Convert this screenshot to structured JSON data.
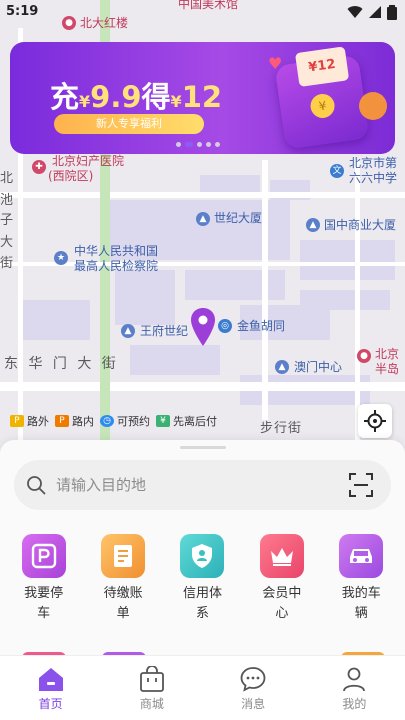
{
  "status_bar": {
    "time": "5:19"
  },
  "map": {
    "labels": [
      "北大红楼",
      "中国美术馆",
      "北京妇产医院",
      "(西院区)",
      "北京市第",
      "六六中学",
      "世纪大厦",
      "国中商业大厦",
      "中华人民共和国",
      "最高人民检察院",
      "王府世纪",
      "金鱼胡同",
      "澳门中心",
      "北京",
      "半岛",
      "东 华 门 大 街",
      "步行街",
      "北",
      "池",
      "子",
      "大",
      "街"
    ],
    "legend": [
      {
        "label": "路外",
        "icon": "offstreet-parking-icon",
        "color": "#f0b400"
      },
      {
        "label": "路内",
        "icon": "onstreet-parking-icon",
        "color": "#f07a00"
      },
      {
        "label": "可预约",
        "icon": "clock-icon",
        "color": "#2d8cf0"
      },
      {
        "label": "先离后付",
        "icon": "pay-later-icon",
        "color": "#3bb273"
      }
    ]
  },
  "banner": {
    "prefix": "充",
    "yen1": "¥",
    "amount1": "9.9",
    "middle": "得",
    "yen2": "¥",
    "amount2": "12",
    "tag": "新人专享福利",
    "envelope_amount": "¥12",
    "coin": "¥"
  },
  "search": {
    "placeholder": "请输入目的地"
  },
  "grid": [
    {
      "label": "我要停车",
      "icon": "parking-icon",
      "color": "#c050e0"
    },
    {
      "label": "待缴账单",
      "icon": "bill-icon",
      "color": "#f0a040"
    },
    {
      "label": "信用体系",
      "icon": "shield-user-icon",
      "color": "#3cc0c0"
    },
    {
      "label": "会员中心",
      "icon": "crown-icon",
      "color": "#f05a7a"
    },
    {
      "label": "我的车辆",
      "icon": "car-icon",
      "color": "#b060e8"
    }
  ],
  "tabs": [
    {
      "label": "首页",
      "icon": "home-icon",
      "active": true
    },
    {
      "label": "商城",
      "icon": "shopping-bag-icon",
      "active": false
    },
    {
      "label": "消息",
      "icon": "message-icon",
      "active": false
    },
    {
      "label": "我的",
      "icon": "user-icon",
      "active": false
    }
  ],
  "colors": {
    "accent": "#7a3fe0",
    "banner": "#8b34e0"
  }
}
